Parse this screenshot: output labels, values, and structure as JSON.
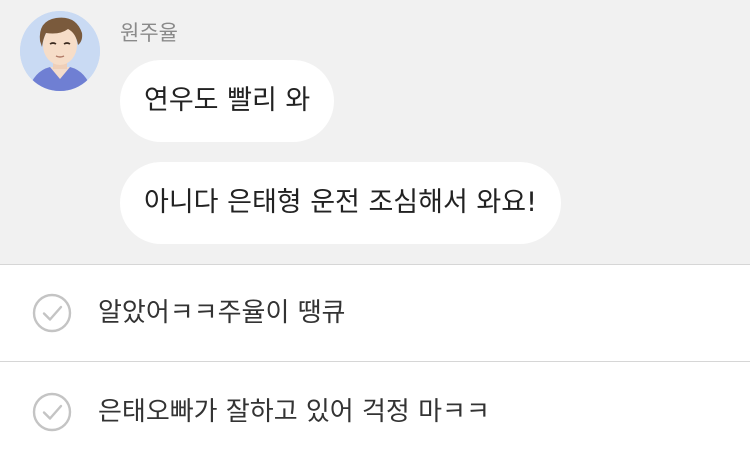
{
  "chat": {
    "sender_name": "원주율",
    "messages": [
      {
        "text": "연우도 빨리 와"
      },
      {
        "text": "아니다 은태형 운전 조심해서 와요!"
      }
    ]
  },
  "reply_options": [
    {
      "label": "알았어ㅋㅋ주율이 땡큐",
      "icon": "check-circle-icon"
    },
    {
      "label": "은태오빠가 잘하고 있어 걱정 마ㅋㅋ",
      "icon": "check-circle-icon"
    }
  ],
  "colors": {
    "chat_background": "#f1f1f1",
    "bubble": "#ffffff",
    "divider": "#d6d6d6",
    "check_icon": "#c4c4c4"
  }
}
